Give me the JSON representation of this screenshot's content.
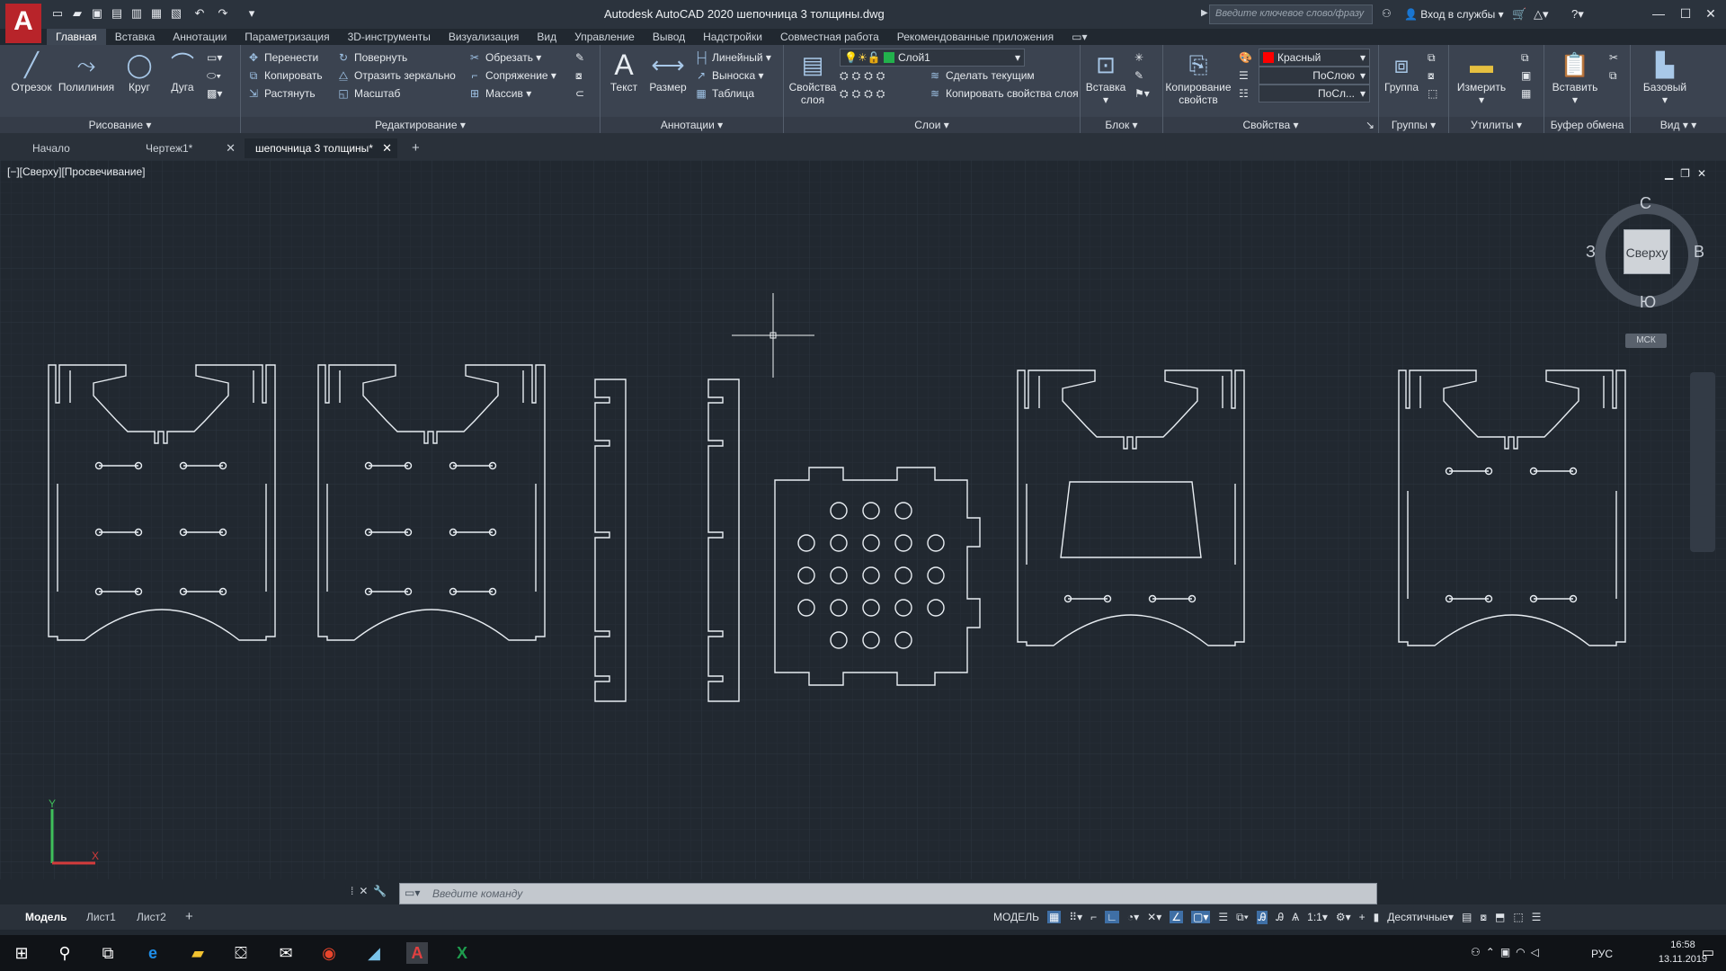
{
  "titlebar": {
    "title": "Autodesk AutoCAD 2020   шепочница 3 толщины.dwg",
    "search_placeholder": "Введите ключевое слово/фразу",
    "signin": "Вход в службы",
    "app_letter": "A"
  },
  "menu_tabs": [
    "Главная",
    "Вставка",
    "Аннотации",
    "Параметризация",
    "3D-инструменты",
    "Визуализация",
    "Вид",
    "Управление",
    "Вывод",
    "Надстройки",
    "Совместная работа",
    "Рекомендованные приложения"
  ],
  "ribbon": {
    "draw": {
      "title": "Рисование",
      "line": "Отрезок",
      "polyline": "Полилиния",
      "circle": "Круг",
      "arc": "Дуга"
    },
    "modify": {
      "title": "Редактирование",
      "move": "Перенести",
      "rotate": "Повернуть",
      "trim": "Обрезать",
      "copy": "Копировать",
      "mirror": "Отразить зеркально",
      "fillet": "Сопряжение",
      "stretch": "Растянуть",
      "scale": "Масштаб",
      "array": "Массив"
    },
    "annotation": {
      "title": "Аннотации",
      "text": "Текст",
      "dimension": "Размер",
      "linear": "Линейный",
      "leader": "Выноска",
      "table": "Таблица"
    },
    "layers": {
      "title": "Слои",
      "props_line1": "Свойства",
      "props_line2": "слоя",
      "current_layer": "Слой1",
      "make_current": "Сделать текущим",
      "match_layer": "Копировать свойства слоя"
    },
    "block": {
      "title": "Блок",
      "insert": "Вставка"
    },
    "properties": {
      "title": "Свойства",
      "match_line1": "Копирование",
      "match_line2": "свойств",
      "color": "Красный",
      "linetype": "ПоСлою",
      "lineweight": "ПоСл..."
    },
    "groups": {
      "title": "Группы",
      "group": "Группа"
    },
    "utilities": {
      "title": "Утилиты",
      "measure": "Измерить"
    },
    "clipboard": {
      "title": "Буфер обмена",
      "paste": "Вставить"
    },
    "view": {
      "title": "Вид",
      "base": "Базовый"
    }
  },
  "file_tabs": [
    {
      "label": "Начало"
    },
    {
      "label": "Чертеж1*"
    },
    {
      "label": "шепочница 3 толщины*"
    }
  ],
  "viewport": {
    "label": "[−][Сверху][Просвечивание]",
    "viewcube": {
      "face": "Сверху",
      "north": "С",
      "south": "Ю",
      "west": "З",
      "east": "В"
    },
    "wcs": "МСК"
  },
  "command": {
    "placeholder": "Введите команду"
  },
  "layout_tabs": [
    "Модель",
    "Лист1",
    "Лист2"
  ],
  "status": {
    "model": "МОДЕЛЬ",
    "scale": "1:1",
    "units": "Десятичные"
  },
  "taskbar": {
    "lang": "РУС",
    "time": "16:58",
    "date": "13.11.2019"
  },
  "colors": {
    "accent": "#b8242a",
    "drawing_line": "#e8edf2",
    "background": "#212830",
    "layer_green": "#22b14c",
    "color_red": "#ff0000"
  }
}
